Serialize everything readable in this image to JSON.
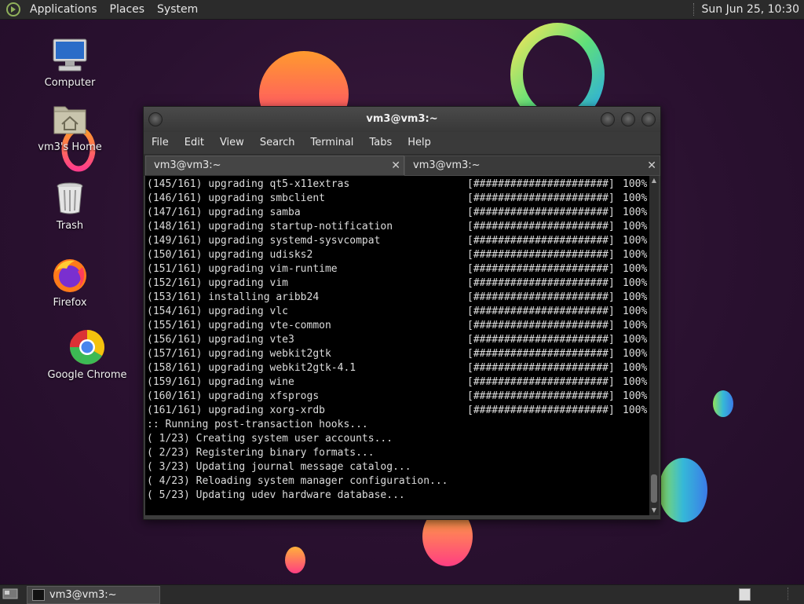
{
  "top_panel": {
    "menus": [
      "Applications",
      "Places",
      "System"
    ],
    "clock": "Sun Jun 25, 10:30"
  },
  "desktop": {
    "icons": [
      {
        "label": "Computer",
        "icon": "computer-icon"
      },
      {
        "label": "vm3's Home",
        "icon": "home-folder-icon"
      },
      {
        "label": "Trash",
        "icon": "trash-icon"
      },
      {
        "label": "Firefox",
        "icon": "firefox-icon"
      },
      {
        "label": "Google Chrome",
        "icon": "chrome-icon"
      }
    ]
  },
  "window": {
    "title": "vm3@vm3:~",
    "menus": [
      "File",
      "Edit",
      "View",
      "Search",
      "Terminal",
      "Tabs",
      "Help"
    ],
    "tabs": [
      {
        "label": "vm3@vm3:~",
        "active": true
      },
      {
        "label": "vm3@vm3:~",
        "active": false
      }
    ],
    "progress_bar": "[######################]",
    "progress_pct": "100%",
    "package_lines": [
      "(145/161) upgrading qt5-x11extras",
      "(146/161) upgrading smbclient",
      "(147/161) upgrading samba",
      "(148/161) upgrading startup-notification",
      "(149/161) upgrading systemd-sysvcompat",
      "(150/161) upgrading udisks2",
      "(151/161) upgrading vim-runtime",
      "(152/161) upgrading vim",
      "(153/161) installing aribb24",
      "(154/161) upgrading vlc",
      "(155/161) upgrading vte-common",
      "(156/161) upgrading vte3",
      "(157/161) upgrading webkit2gtk",
      "(158/161) upgrading webkit2gtk-4.1",
      "(159/161) upgrading wine",
      "(160/161) upgrading xfsprogs",
      "(161/161) upgrading xorg-xrdb"
    ],
    "hook_lines": [
      ":: Running post-transaction hooks...",
      "( 1/23) Creating system user accounts...",
      "( 2/23) Registering binary formats...",
      "( 3/23) Updating journal message catalog...",
      "( 4/23) Reloading system manager configuration...",
      "( 5/23) Updating udev hardware database..."
    ]
  },
  "taskbar": {
    "task_label": "vm3@vm3:~"
  }
}
